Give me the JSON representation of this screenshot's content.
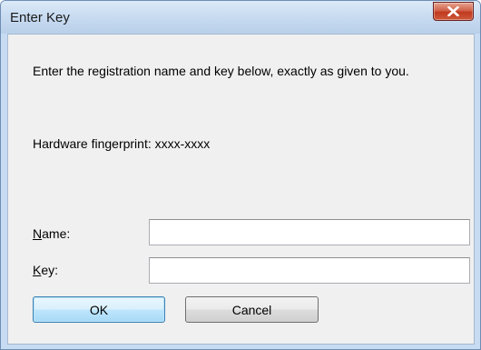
{
  "window": {
    "title": "Enter Key"
  },
  "dialog": {
    "instructions": "Enter the registration name and key below, exactly as given to you.",
    "fingerprint_label": "Hardware fingerprint:",
    "fingerprint_value": "xxxx-xxxx",
    "name_label_accel": "N",
    "name_label_rest": "ame:",
    "name_value": "",
    "key_label_accel": "K",
    "key_label_rest": "ey:",
    "key_value": ""
  },
  "buttons": {
    "ok": "OK",
    "cancel": "Cancel"
  },
  "icons": {
    "close": "close-icon"
  },
  "colors": {
    "frame": "#c7dcf2",
    "client": "#f0f0f0",
    "close_button": "#c0391f",
    "default_button_border": "#3c7fb1"
  }
}
